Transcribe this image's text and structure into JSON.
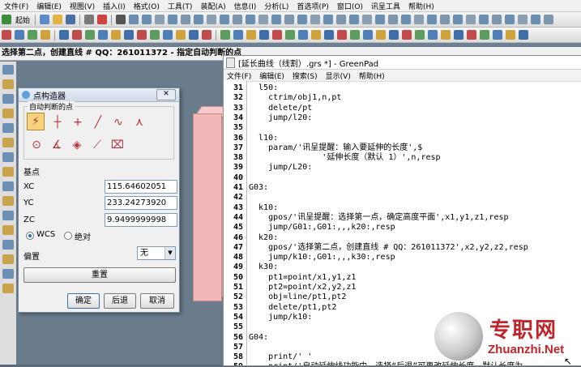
{
  "cad": {
    "menu": [
      "文件(F)",
      "编辑(E)",
      "视图(V)",
      "插入(I)",
      "格式(O)",
      "工具(T)",
      "装配(A)",
      "信息(I)",
      "分析(L)",
      "首选项(P)",
      "窗口(O)",
      "讯呈工具",
      "帮助(H)"
    ],
    "toolbar": {
      "start_label": "起始"
    },
    "status_prompt": "选择第二点，创建直线 # QQ：261011372 - 指定自动判断的点"
  },
  "point_dialog": {
    "title": "点构造器",
    "group_title": "自动判断的点",
    "base_point_label": "基点",
    "xc_label": "XC",
    "xc_value": "115.64602051",
    "yc_label": "YC",
    "yc_value": "233.24273920",
    "zc_label": "ZC",
    "zc_value": "9.9499999998",
    "wcs_label": "WCS",
    "absolute_label": "绝对",
    "offset_label": "偏置",
    "offset_value": "无",
    "reset_label": "重置",
    "ok_label": "确定",
    "back_label": "后退",
    "cancel_label": "取消"
  },
  "greenpad": {
    "title": "[延长曲线（线割）.grs *] - GreenPad",
    "menu": [
      "文件(F)",
      "编辑(E)",
      "搜索(S)",
      "显示(V)",
      "帮助(H)"
    ],
    "lines": [
      {
        "n": "31",
        "t": "  l50:"
      },
      {
        "n": "32",
        "t": "    ctrim/obj1,n,pt"
      },
      {
        "n": "33",
        "t": "    delete/pt"
      },
      {
        "n": "34",
        "t": "    jump/l20:"
      },
      {
        "n": "35",
        "t": ""
      },
      {
        "n": "36",
        "t": "  l10:"
      },
      {
        "n": "37",
        "t": "    param/'讯呈提醒：输入要延伸的长度',$"
      },
      {
        "n": "38",
        "t": "               '延伸长度（默认 1）',n,resp"
      },
      {
        "n": "39",
        "t": "    jump/L20:"
      },
      {
        "n": "40",
        "t": ""
      },
      {
        "n": "41",
        "t": "G03:"
      },
      {
        "n": "42",
        "t": ""
      },
      {
        "n": "43",
        "t": "  k10:"
      },
      {
        "n": "44",
        "t": "    gpos/'讯呈提醒：选择第一点，确定高度平面',x1,y1,z1,resp"
      },
      {
        "n": "45",
        "t": "    jump/G01:,G01:,,,k20:,resp"
      },
      {
        "n": "46",
        "t": "  k20:"
      },
      {
        "n": "47",
        "t": "    gpos/'选择第二点，创建直线 # QQ：261011372',x2,y2,z2,resp"
      },
      {
        "n": "48",
        "t": "    jump/k10:,G01:,,,k30:,resp"
      },
      {
        "n": "49",
        "t": "  k30:"
      },
      {
        "n": "50",
        "t": "    pt1=point/x1,y1,z1"
      },
      {
        "n": "51",
        "t": "    pt2=point/x2,y2,z1"
      },
      {
        "n": "52",
        "t": "    obj=line/pt1,pt2"
      },
      {
        "n": "53",
        "t": "    delete/pt1,pt2"
      },
      {
        "n": "54",
        "t": "    jump/k10:"
      },
      {
        "n": "55",
        "t": ""
      },
      {
        "n": "56",
        "t": "G04:"
      },
      {
        "n": "57",
        "t": ""
      },
      {
        "n": "58",
        "t": "    print/' '"
      },
      {
        "n": "59",
        "t": "    print/'自动延伸线功能中，选择“后退”可更改延伸长度，默认长度为"
      }
    ]
  },
  "watermark": {
    "cn": "专职网",
    "en": "Zhuanzhi.Net"
  }
}
